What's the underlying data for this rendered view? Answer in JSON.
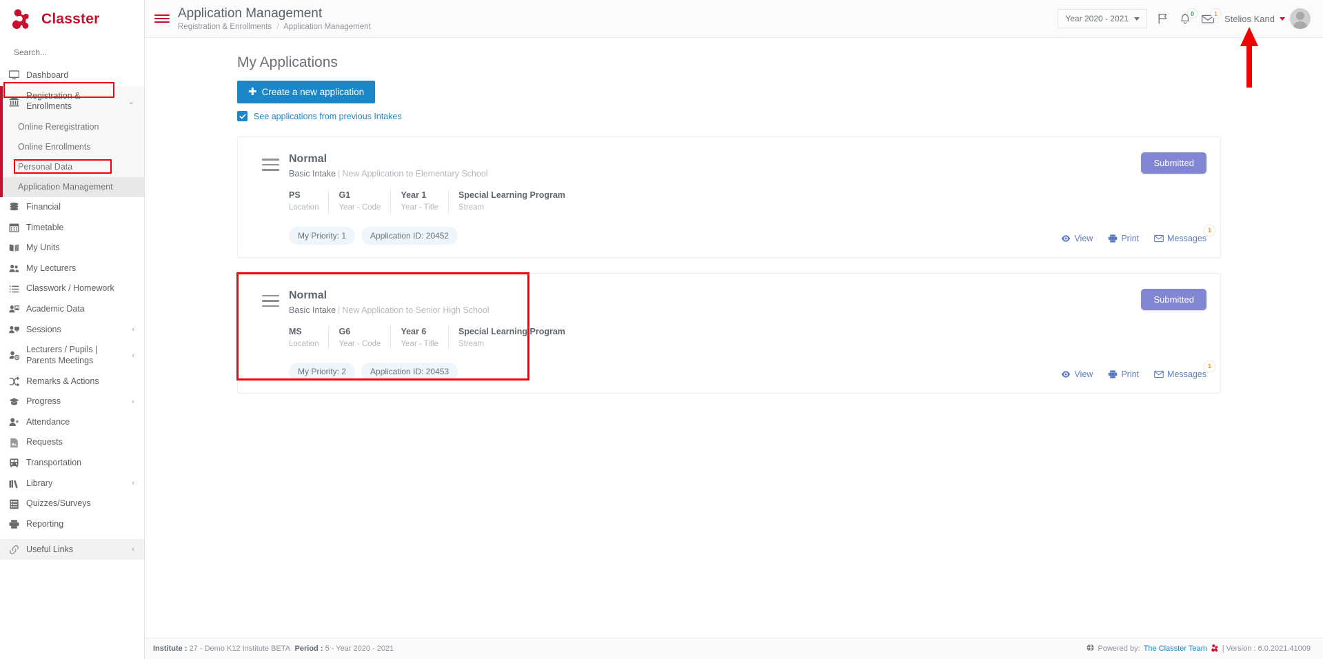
{
  "brand": {
    "name": "Classter",
    "logo_icon": "classter-logo-icon"
  },
  "sidebar": {
    "search_placeholder": "Search...",
    "items": [
      {
        "label": "Dashboard",
        "icon": "monitor-icon"
      },
      {
        "label": "Registration & Enrollments",
        "icon": "bank-icon"
      },
      {
        "label": "Online Reregistration"
      },
      {
        "label": "Online Enrollments"
      },
      {
        "label": "Personal Data"
      },
      {
        "label": "Application Management"
      },
      {
        "label": "Financial",
        "icon": "coins-icon"
      },
      {
        "label": "Timetable",
        "icon": "calendar-icon"
      },
      {
        "label": "My Units",
        "icon": "book-icon"
      },
      {
        "label": "My Lecturers",
        "icon": "users-icon"
      },
      {
        "label": "Classwork / Homework",
        "icon": "tasklist-icon"
      },
      {
        "label": "Academic Data",
        "icon": "user-card-icon"
      },
      {
        "label": "Sessions",
        "icon": "presentation-icon"
      },
      {
        "label": "Lecturers / Pupils | Parents Meetings",
        "icon": "user-clock-icon"
      },
      {
        "label": "Remarks & Actions",
        "icon": "shuffle-icon"
      },
      {
        "label": "Progress",
        "icon": "graduation-cap-icon"
      },
      {
        "label": "Attendance",
        "icon": "user-check-icon"
      },
      {
        "label": "Requests",
        "icon": "document-icon"
      },
      {
        "label": "Transportation",
        "icon": "bus-icon"
      },
      {
        "label": "Library",
        "icon": "books-icon"
      },
      {
        "label": "Quizzes/Surveys",
        "icon": "checklist-icon"
      },
      {
        "label": "Reporting",
        "icon": "printer-icon"
      },
      {
        "label": "Useful Links",
        "icon": "link-icon"
      }
    ]
  },
  "header": {
    "title": "Application Management",
    "breadcrumb_parent": "Registration & Enrollments",
    "breadcrumb_current": "Application Management",
    "year_selector": "Year 2020 - 2021",
    "flag_icon": "flag-icon",
    "bell_icon": "bell-icon",
    "bell_count": "0",
    "envelope_icon": "envelope-icon",
    "envelope_count": "1",
    "username": "Stelios Kand"
  },
  "main": {
    "heading": "My Applications",
    "create_button": "Create a new application",
    "checkbox_label": "See applications from previous Intakes",
    "checkbox_checked": true,
    "meta_labels": {
      "location": "Location",
      "year_code": "Year - Code",
      "year_title": "Year - Title",
      "stream": "Stream"
    },
    "actions": {
      "view": "View",
      "print": "Print",
      "messages": "Messages"
    },
    "applications": [
      {
        "title": "Normal",
        "intake": "Basic Intake",
        "description": "New Application to Elementary School",
        "location": "PS",
        "year_code": "G1",
        "year_title": "Year 1",
        "stream": "Special Learning Program",
        "priority": "My Priority: 1",
        "application_id": "Application ID: 20452",
        "status": "Submitted",
        "message_count": "1",
        "highlighted": false
      },
      {
        "title": "Normal",
        "intake": "Basic Intake",
        "description": "New Application to Senior High School",
        "location": "MS",
        "year_code": "G6",
        "year_title": "Year 6",
        "stream": "Special Learning Program",
        "priority": "My Priority: 2",
        "application_id": "Application ID: 20453",
        "status": "Submitted",
        "message_count": "1",
        "highlighted": true
      }
    ]
  },
  "footer": {
    "institute_label": "Institute :",
    "institute_value": "27 - Demo K12 Institute BETA",
    "period_label": "Period :",
    "period_value": "5 - Year 2020 - 2021",
    "powered_by": "Powered by:",
    "team_link": "The Classter Team",
    "version": "| Version : 6.0.2021.41009"
  },
  "colors": {
    "brand_red": "#c8102e",
    "accent_blue": "#1b86c8",
    "status_purple": "#8186d4",
    "annotation_red": "#f40000"
  }
}
